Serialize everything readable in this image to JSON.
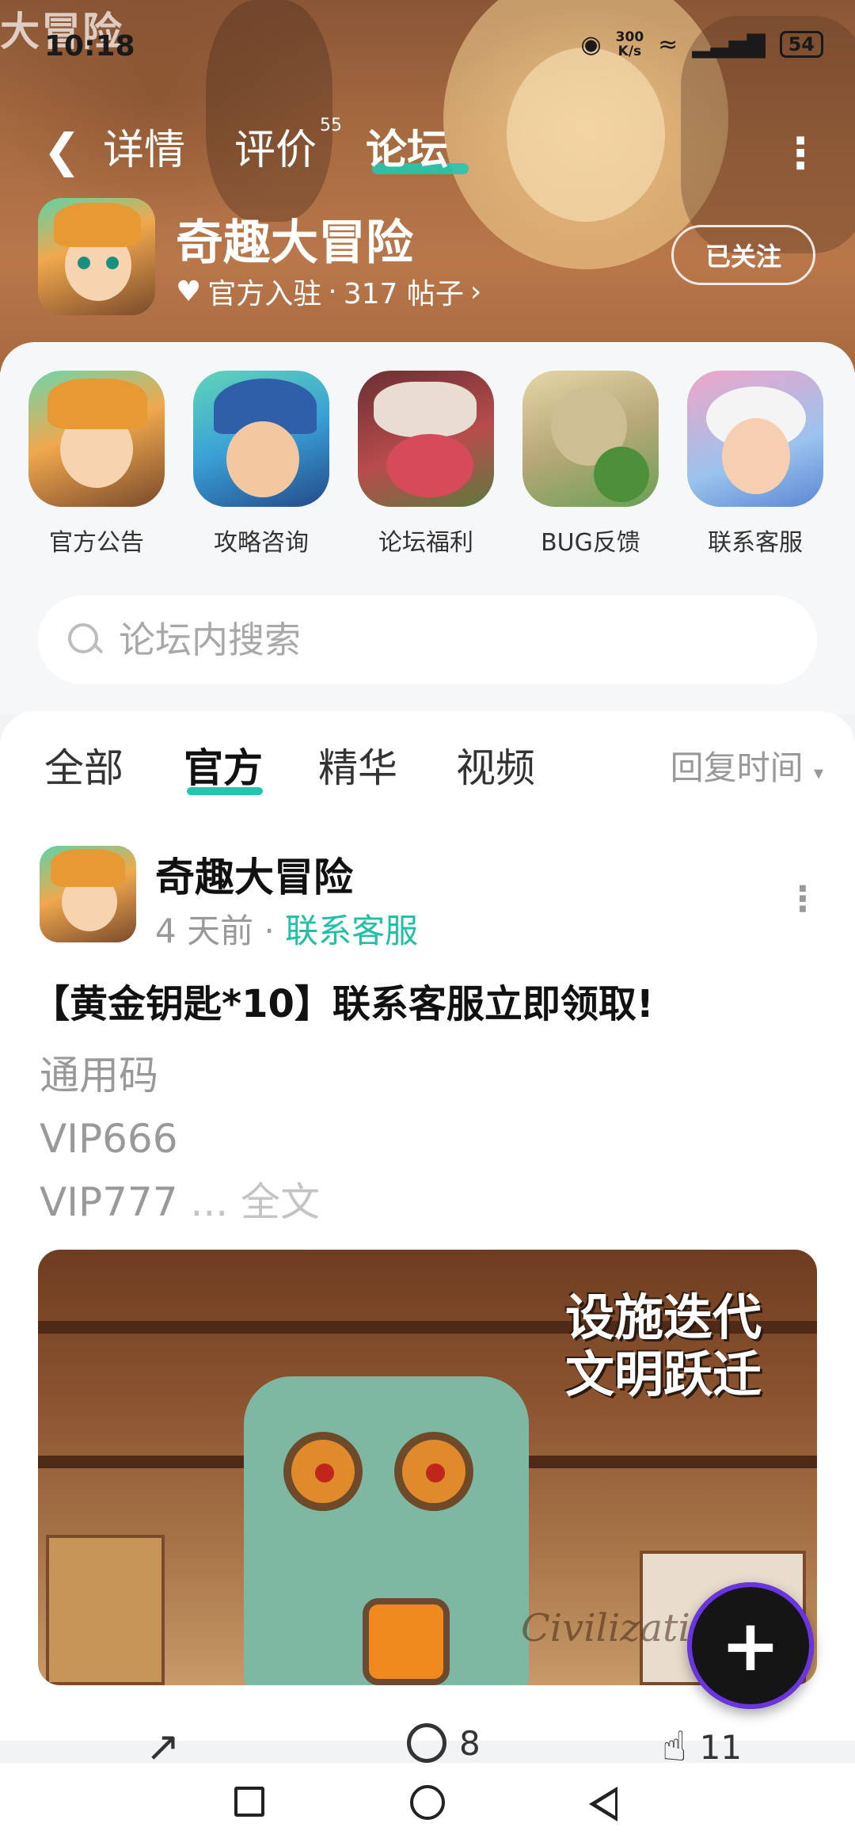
{
  "status_bar": {
    "time": "10:18",
    "speed_value": "300",
    "speed_unit": "K/s",
    "battery": "54"
  },
  "hero": {
    "logo_text": "大冒险"
  },
  "nav": {
    "tabs": [
      {
        "label": "详情"
      },
      {
        "label": "评价",
        "badge": "55"
      },
      {
        "label": "论坛"
      }
    ]
  },
  "game": {
    "title": "奇趣大冒险",
    "official": "官方入驻",
    "dot": "·",
    "posts": "317 帖子",
    "follow_label": "已关注"
  },
  "categories": [
    {
      "label": "官方公告"
    },
    {
      "label": "攻略咨询"
    },
    {
      "label": "论坛福利"
    },
    {
      "label": "BUG反馈"
    },
    {
      "label": "联系客服"
    }
  ],
  "search": {
    "placeholder": "论坛内搜索"
  },
  "feed": {
    "tabs": [
      {
        "label": "全部"
      },
      {
        "label": "官方"
      },
      {
        "label": "精华"
      },
      {
        "label": "视频"
      }
    ],
    "sort_label": "回复时间",
    "post": {
      "author": "奇趣大冒险",
      "time": "4 天前",
      "dot": "·",
      "tag": "联系客服",
      "title": "【黄金钥匙*10】联系客服立即领取!",
      "lines": [
        "通用码",
        "VIP666",
        "VIP777"
      ],
      "ellipsis": "...",
      "full_text_label": "全文",
      "image_caption": [
        "设施迭代",
        "文明跃迁"
      ],
      "image_watermark": "Civilizati",
      "comments": "8",
      "likes": "11"
    }
  },
  "colors": {
    "accent": "#25c6b0",
    "tag": "#1fbfa8",
    "fab": "#151515"
  }
}
